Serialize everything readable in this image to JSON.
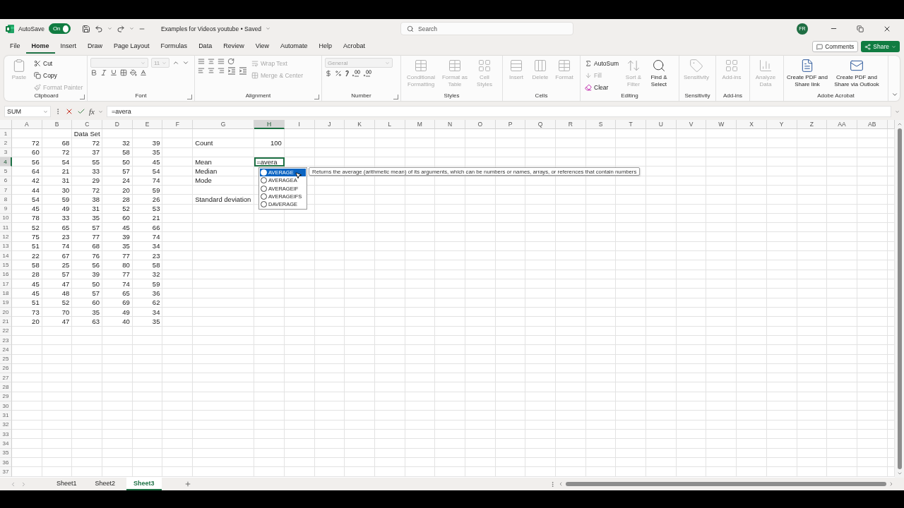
{
  "title_bar": {
    "autosave": {
      "label": "AutoSave",
      "on": true,
      "state_label": "On"
    },
    "document_title": "Examples for Videos youtube • Saved",
    "search": {
      "placeholder": "Search"
    },
    "avatar": "FR"
  },
  "ribbon_tabs": [
    {
      "label": "File",
      "selected": false
    },
    {
      "label": "Home",
      "selected": true
    },
    {
      "label": "Insert",
      "selected": false
    },
    {
      "label": "Draw",
      "selected": false
    },
    {
      "label": "Page Layout",
      "selected": false
    },
    {
      "label": "Formulas",
      "selected": false
    },
    {
      "label": "Data",
      "selected": false
    },
    {
      "label": "Review",
      "selected": false
    },
    {
      "label": "View",
      "selected": false
    },
    {
      "label": "Automate",
      "selected": false
    },
    {
      "label": "Help",
      "selected": false
    },
    {
      "label": "Acrobat",
      "selected": false
    }
  ],
  "comments_button": "Comments",
  "share_button": "Share",
  "ribbon": {
    "groups": [
      {
        "kind": "clipboard",
        "label": "Clipboard",
        "launcher": true,
        "items": [
          {
            "label": "Paste",
            "disabled": true
          },
          {
            "label": "Cut",
            "disabled": false
          },
          {
            "label": "Copy",
            "disabled": false
          },
          {
            "label": "Format Painter",
            "disabled": true
          }
        ]
      },
      {
        "kind": "font",
        "label": "Font",
        "launcher": true,
        "font_size": "11",
        "disabled": true
      },
      {
        "kind": "alignment",
        "label": "Alignment",
        "launcher": true,
        "items": [
          {
            "label": "Wrap Text",
            "disabled": true
          },
          {
            "label": "Merge & Center",
            "disabled": true
          }
        ]
      },
      {
        "kind": "number",
        "label": "Number",
        "launcher": true,
        "format": "General",
        "disabled": true
      },
      {
        "kind": "large",
        "label": "Styles",
        "launcher": false,
        "items": [
          {
            "label": "Conditional Formatting",
            "disabled": true
          },
          {
            "label": "Format as Table",
            "disabled": true
          },
          {
            "label": "Cell Styles",
            "disabled": true
          }
        ]
      },
      {
        "kind": "large",
        "label": "Cells",
        "launcher": false,
        "items": [
          {
            "label": "Insert",
            "disabled": true
          },
          {
            "label": "Delete",
            "disabled": true
          },
          {
            "label": "Format",
            "disabled": true
          }
        ]
      },
      {
        "kind": "editing",
        "label": "Editing",
        "launcher": false,
        "items": [
          {
            "label": "AutoSum",
            "disabled": false
          },
          {
            "label": "Fill",
            "disabled": true
          },
          {
            "label": "Clear",
            "disabled": false
          },
          {
            "label": "Sort & Filter",
            "disabled": true
          },
          {
            "label": "Find & Select",
            "disabled": false
          }
        ]
      },
      {
        "kind": "large",
        "label": "Sensitivity",
        "launcher": false,
        "items": [
          {
            "label": "Sensitivity",
            "disabled": true
          }
        ]
      },
      {
        "kind": "large",
        "label": "Add-ins",
        "launcher": false,
        "items": [
          {
            "label": "Add-ins",
            "disabled": true
          }
        ]
      },
      {
        "kind": "large",
        "launcher": false,
        "items": [
          {
            "label": "Analyze Data",
            "disabled": true
          }
        ]
      },
      {
        "kind": "large",
        "label": "Adobe Acrobat",
        "launcher": false,
        "items": [
          {
            "label": "Create PDF and Share link",
            "disabled": false
          },
          {
            "label": "Create PDF and Share via Outlook",
            "disabled": false
          }
        ]
      }
    ]
  },
  "formula_bar": {
    "name_box": "SUM",
    "function_label": "fx",
    "formula": "=avera"
  },
  "sheet": {
    "columns": [
      {
        "label": "A",
        "selected": false
      },
      {
        "label": "B",
        "selected": false
      },
      {
        "label": "C",
        "selected": false
      },
      {
        "label": "D",
        "selected": false
      },
      {
        "label": "E",
        "selected": false
      },
      {
        "label": "F",
        "selected": false
      },
      {
        "label": "G",
        "selected": false
      },
      {
        "label": "H",
        "selected": true
      },
      {
        "label": "I",
        "selected": false
      },
      {
        "label": "J",
        "selected": false
      },
      {
        "label": "K",
        "selected": false
      },
      {
        "label": "L",
        "selected": false
      },
      {
        "label": "M",
        "selected": false
      },
      {
        "label": "N",
        "selected": false
      },
      {
        "label": "O",
        "selected": false
      },
      {
        "label": "P",
        "selected": false
      },
      {
        "label": "Q",
        "selected": false
      },
      {
        "label": "R",
        "selected": false
      },
      {
        "label": "S",
        "selected": false
      },
      {
        "label": "T",
        "selected": false
      },
      {
        "label": "U",
        "selected": false
      },
      {
        "label": "V",
        "selected": false
      },
      {
        "label": "W",
        "selected": false
      },
      {
        "label": "X",
        "selected": false
      },
      {
        "label": "Y",
        "selected": false
      },
      {
        "label": "Z",
        "selected": false
      },
      {
        "label": "AA",
        "selected": false
      },
      {
        "label": "AB",
        "selected": false
      }
    ],
    "rows": [
      {
        "number": "1",
        "selected": false,
        "kind": "heading",
        "cells": [
          null,
          null,
          "Data Set"
        ]
      },
      {
        "number": "2",
        "selected": false,
        "kind": "data",
        "cells": [
          "72",
          "68",
          "72",
          "32",
          "39",
          null,
          "Count",
          "100"
        ]
      },
      {
        "number": "3",
        "selected": false,
        "kind": "data",
        "cells": [
          "60",
          "72",
          "37",
          "58",
          "35"
        ]
      },
      {
        "number": "4",
        "selected": true,
        "kind": "data",
        "cells": [
          "56",
          "54",
          "55",
          "50",
          "45",
          null,
          "Mean",
          "=avera"
        ]
      },
      {
        "number": "5",
        "selected": false,
        "kind": "data",
        "cells": [
          "64",
          "21",
          "33",
          "57",
          "54",
          null,
          "Median"
        ]
      },
      {
        "number": "6",
        "selected": false,
        "kind": "data",
        "cells": [
          "42",
          "31",
          "29",
          "24",
          "74",
          null,
          "Mode"
        ]
      },
      {
        "number": "7",
        "selected": false,
        "kind": "data",
        "cells": [
          "44",
          "30",
          "72",
          "20",
          "59"
        ]
      },
      {
        "number": "8",
        "selected": false,
        "kind": "data",
        "cells": [
          "54",
          "59",
          "38",
          "28",
          "26",
          null,
          "Standard deviation"
        ]
      },
      {
        "number": "9",
        "selected": false,
        "kind": "data",
        "cells": [
          "45",
          "49",
          "31",
          "52",
          "53"
        ]
      },
      {
        "number": "10",
        "selected": false,
        "kind": "data",
        "cells": [
          "78",
          "33",
          "35",
          "60",
          "21"
        ]
      },
      {
        "number": "11",
        "selected": false,
        "kind": "data",
        "cells": [
          "52",
          "65",
          "57",
          "45",
          "66"
        ]
      },
      {
        "number": "12",
        "selected": false,
        "kind": "data",
        "cells": [
          "75",
          "23",
          "77",
          "39",
          "74"
        ]
      },
      {
        "number": "13",
        "selected": false,
        "kind": "data",
        "cells": [
          "51",
          "74",
          "68",
          "35",
          "34"
        ]
      },
      {
        "number": "14",
        "selected": false,
        "kind": "data",
        "cells": [
          "22",
          "67",
          "76",
          "77",
          "23"
        ]
      },
      {
        "number": "15",
        "selected": false,
        "kind": "data",
        "cells": [
          "58",
          "25",
          "56",
          "80",
          "58"
        ]
      },
      {
        "number": "16",
        "selected": false,
        "kind": "data",
        "cells": [
          "28",
          "57",
          "39",
          "77",
          "32"
        ]
      },
      {
        "number": "17",
        "selected": false,
        "kind": "data",
        "cells": [
          "45",
          "47",
          "50",
          "74",
          "59"
        ]
      },
      {
        "number": "18",
        "selected": false,
        "kind": "data",
        "cells": [
          "45",
          "48",
          "57",
          "65",
          "36"
        ]
      },
      {
        "number": "19",
        "selected": false,
        "kind": "data",
        "cells": [
          "51",
          "52",
          "60",
          "69",
          "62"
        ]
      },
      {
        "number": "20",
        "selected": false,
        "kind": "data",
        "cells": [
          "73",
          "70",
          "35",
          "49",
          "34"
        ]
      },
      {
        "number": "21",
        "selected": false,
        "kind": "data",
        "cells": [
          "20",
          "47",
          "63",
          "40",
          "35"
        ]
      },
      {
        "number": "22",
        "selected": false
      },
      {
        "number": "23",
        "selected": false
      },
      {
        "number": "24",
        "selected": false
      },
      {
        "number": "25",
        "selected": false
      },
      {
        "number": "26",
        "selected": false
      },
      {
        "number": "27",
        "selected": false
      },
      {
        "number": "28",
        "selected": false
      },
      {
        "number": "29",
        "selected": false
      },
      {
        "number": "30",
        "selected": false
      },
      {
        "number": "31",
        "selected": false
      },
      {
        "number": "32",
        "selected": false
      },
      {
        "number": "33",
        "selected": false
      },
      {
        "number": "34",
        "selected": false
      },
      {
        "number": "35",
        "selected": false
      },
      {
        "number": "36",
        "selected": false
      },
      {
        "number": "37",
        "selected": false
      }
    ],
    "autocomplete": {
      "items": [
        {
          "label": "AVERAGE",
          "selected": true
        },
        {
          "label": "AVERAGEA",
          "selected": false
        },
        {
          "label": "AVERAGEIF",
          "selected": false
        },
        {
          "label": "AVERAGEIFS",
          "selected": false
        },
        {
          "label": "DAVERAGE",
          "selected": false
        }
      ],
      "tooltip": "Returns the average (arithmetic mean) of its arguments, which can be numbers or names, arrays, or references that contain numbers"
    }
  },
  "sheet_tabs": [
    {
      "label": "Sheet1",
      "selected": false
    },
    {
      "label": "Sheet2",
      "selected": false
    },
    {
      "label": "Sheet3",
      "selected": true
    }
  ]
}
